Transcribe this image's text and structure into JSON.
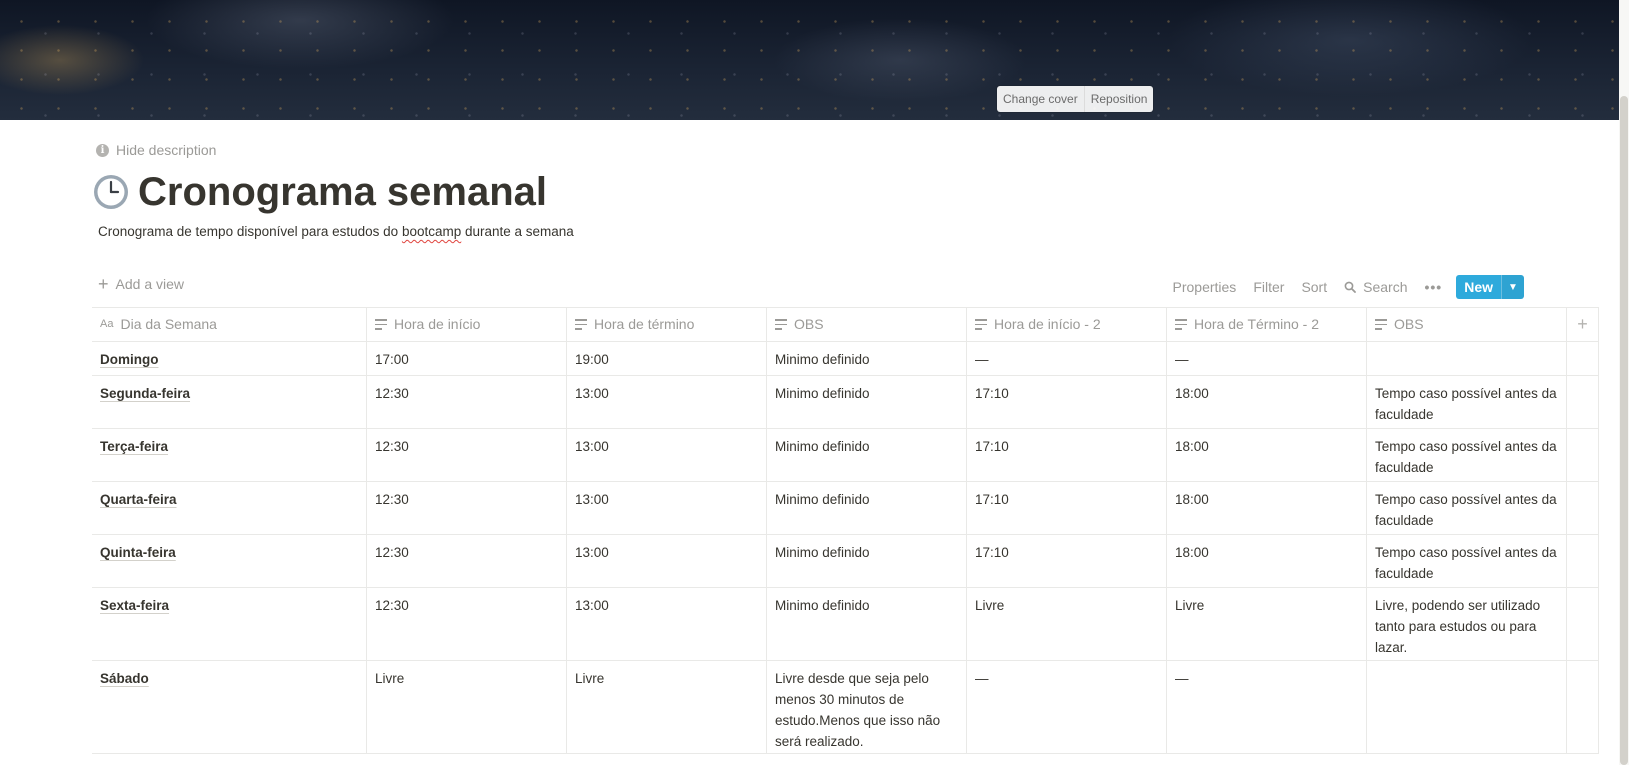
{
  "cover": {
    "change_label": "Change cover",
    "reposition_label": "Reposition"
  },
  "page": {
    "hide_description": "Hide description",
    "title": "Cronograma semanal",
    "description_before": "Cronograma de tempo disponível para estudos do ",
    "description_word": "bootcamp",
    "description_after": " durante a semana"
  },
  "toolbar": {
    "add_view": "Add a view",
    "properties": "Properties",
    "filter": "Filter",
    "sort": "Sort",
    "search": "Search",
    "more": "•••",
    "new": "New"
  },
  "table": {
    "columns": [
      "Dia da Semana",
      "Hora de início",
      "Hora de término",
      "OBS",
      "Hora de início - 2",
      "Hora de Término - 2",
      "OBS"
    ],
    "rows": [
      [
        "Domingo",
        "17:00",
        "19:00",
        "Minimo definido",
        "—",
        "—",
        ""
      ],
      [
        "Segunda-feira",
        "12:30",
        "13:00",
        "Minimo definido",
        "17:10",
        "18:00",
        "Tempo caso possível antes da faculdade"
      ],
      [
        "Terça-feira",
        "12:30",
        "13:00",
        "Minimo definido",
        "17:10",
        "18:00",
        "Tempo caso possível antes da faculdade"
      ],
      [
        "Quarta-feira",
        "12:30",
        "13:00",
        "Minimo definido",
        "17:10",
        "18:00",
        "Tempo caso possível antes da faculdade"
      ],
      [
        "Quinta-feira",
        "12:30",
        "13:00",
        "Minimo definido",
        "17:10",
        "18:00",
        "Tempo caso possível antes da faculdade"
      ],
      [
        "Sexta-feira",
        "12:30",
        "13:00",
        "Minimo definido",
        "Livre",
        "Livre",
        "Livre, podendo ser utilizado tanto para estudos ou para lazar."
      ],
      [
        "Sábado",
        "Livre",
        "Livre",
        "Livre desde que seja pelo menos 30 minutos de estudo.Menos que isso não será realizado.",
        "—",
        "—",
        ""
      ]
    ]
  },
  "colors": {
    "accent": "#2eaadc",
    "text": "#37352f",
    "muted": "#9b9a97",
    "border": "#e9e9e7"
  }
}
